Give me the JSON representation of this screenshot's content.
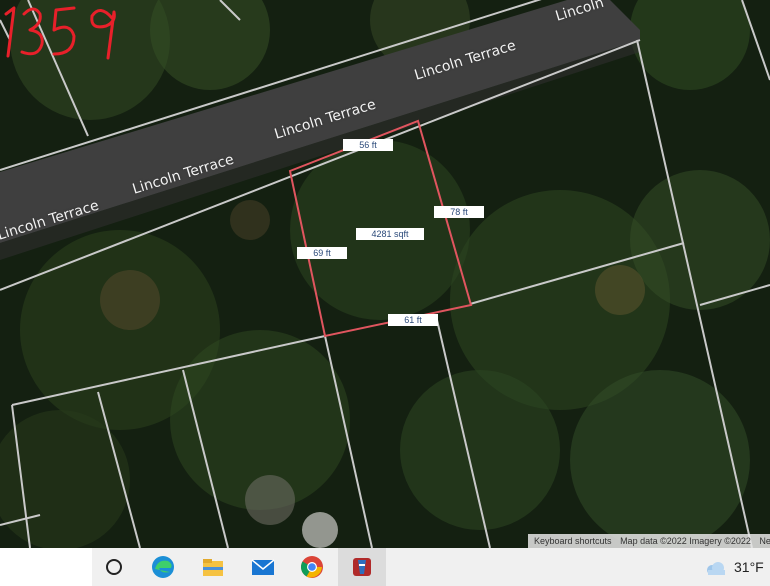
{
  "map": {
    "streets": [
      {
        "label": "Lincoln Terrace"
      },
      {
        "label": "Lincoln Terrace"
      },
      {
        "label": "Lincoln Terrace"
      },
      {
        "label": "Lincoln Terrace"
      },
      {
        "label": "Lincoln Terrace"
      },
      {
        "label": "Lincoln"
      }
    ],
    "parcel": {
      "top_label": "56 ft",
      "right_label": "78 ft",
      "left_label": "69 ft",
      "bottom_label": "61 ft",
      "area_label": "4281 sqft",
      "outline_color": "#e0555f"
    },
    "handwritten_number": "1359",
    "handwriting_color": "#e8202a",
    "attribution": {
      "shortcuts": "Keyboard shortcuts",
      "map_data": "Map data ©2022 Imagery ©2022",
      "cut": "Ne"
    }
  },
  "taskbar": {
    "icons": [
      "cortana-circle-icon",
      "edge-icon",
      "file-explorer-icon",
      "mail-icon",
      "chrome-icon",
      "app-icon"
    ],
    "weather": {
      "temperature": "31°F",
      "icon": "partly-cloudy-icon"
    }
  }
}
